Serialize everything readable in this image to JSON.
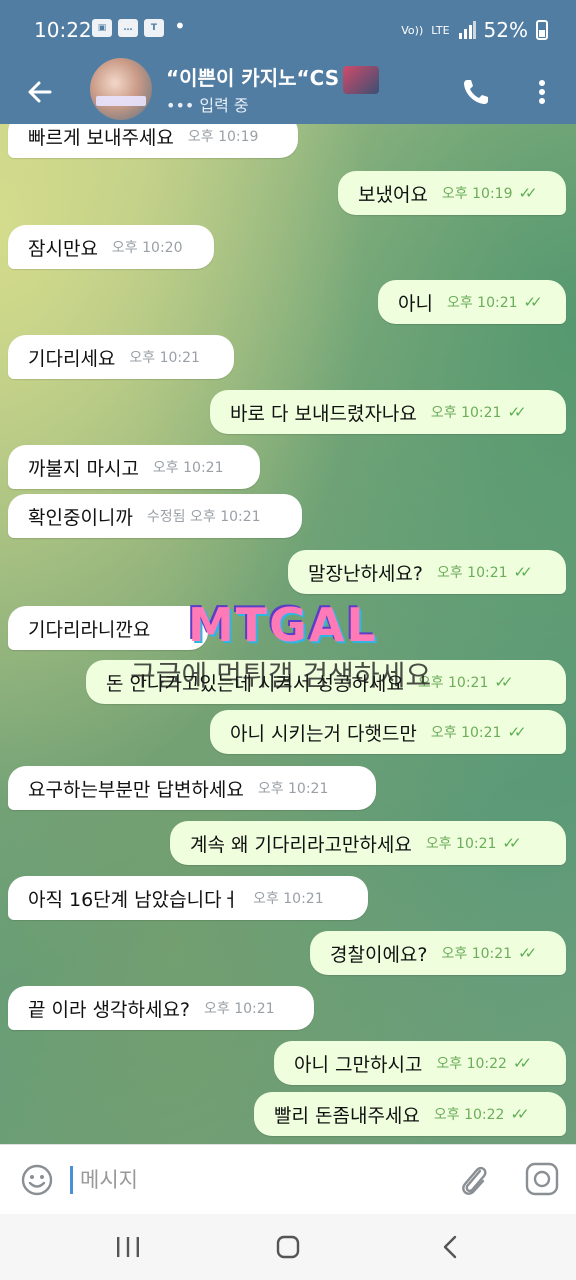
{
  "status_bar": {
    "time": "10:22",
    "network": "LTE",
    "battery": "52%"
  },
  "header": {
    "title": "“이쁜이 카지노“CS",
    "status": "••• 입력 중"
  },
  "messages": [
    {
      "dir": "in",
      "text": "빠르게 보내주세요",
      "time": "오후 10:19"
    },
    {
      "dir": "out",
      "text": "보냈어요",
      "time": "오후 10:19"
    },
    {
      "dir": "in",
      "text": "잠시만요",
      "time": "오후 10:20"
    },
    {
      "dir": "out",
      "text": "아니",
      "time": "오후 10:21"
    },
    {
      "dir": "in",
      "text": "기다리세요",
      "time": "오후 10:21"
    },
    {
      "dir": "out",
      "text": "바로 다 보내드렸자나요",
      "time": "오후 10:21"
    },
    {
      "dir": "in",
      "text": "까불지 마시고",
      "time": "오후 10:21"
    },
    {
      "dir": "in",
      "text": "확인중이니까",
      "time": "수정됨 오후 10:21"
    },
    {
      "dir": "out",
      "text": "말장난하세요?",
      "time": "오후 10:21"
    },
    {
      "dir": "in",
      "text": "기다리라니깐요",
      "time": ""
    },
    {
      "dir": "out",
      "text": "돈 안나가고있는데 시켜서 성공하세요",
      "time": "오후 10:21"
    },
    {
      "dir": "out",
      "text": "아니 시키는거 다햇드만",
      "time": "오후 10:21"
    },
    {
      "dir": "in",
      "text": "요구하는부분만 답변하세요",
      "time": "오후 10:21"
    },
    {
      "dir": "out",
      "text": "계속 왜 기다리라고만하세요",
      "time": "오후 10:21"
    },
    {
      "dir": "in",
      "text": "아직 16단계 남았습니다ㅓ",
      "time": "오후 10:21"
    },
    {
      "dir": "out",
      "text": "경찰이에요?",
      "time": "오후 10:21"
    },
    {
      "dir": "in",
      "text": "끝 이라 생각하세요?",
      "time": "오후 10:21"
    },
    {
      "dir": "out",
      "text": "아니 그만하시고",
      "time": "오후 10:22"
    },
    {
      "dir": "out",
      "text": "빨리 돈좀내주세요",
      "time": "오후 10:22"
    }
  ],
  "watermark": {
    "logo": "MTGAL",
    "text": "구글에 먹튀갤 검색하세요"
  },
  "input": {
    "placeholder": "메시지"
  },
  "colors": {
    "header": "#527da3",
    "incoming_bubble": "#ffffff",
    "outgoing_bubble": "#efffde",
    "time_outgoing": "#6dac5a",
    "caret": "#4a90d9"
  },
  "icons": {
    "back": "arrow-left-icon",
    "call": "phone-icon",
    "more": "more-vertical-icon",
    "emoji": "smiley-icon",
    "attach": "paperclip-icon",
    "camera": "camera-icon"
  }
}
